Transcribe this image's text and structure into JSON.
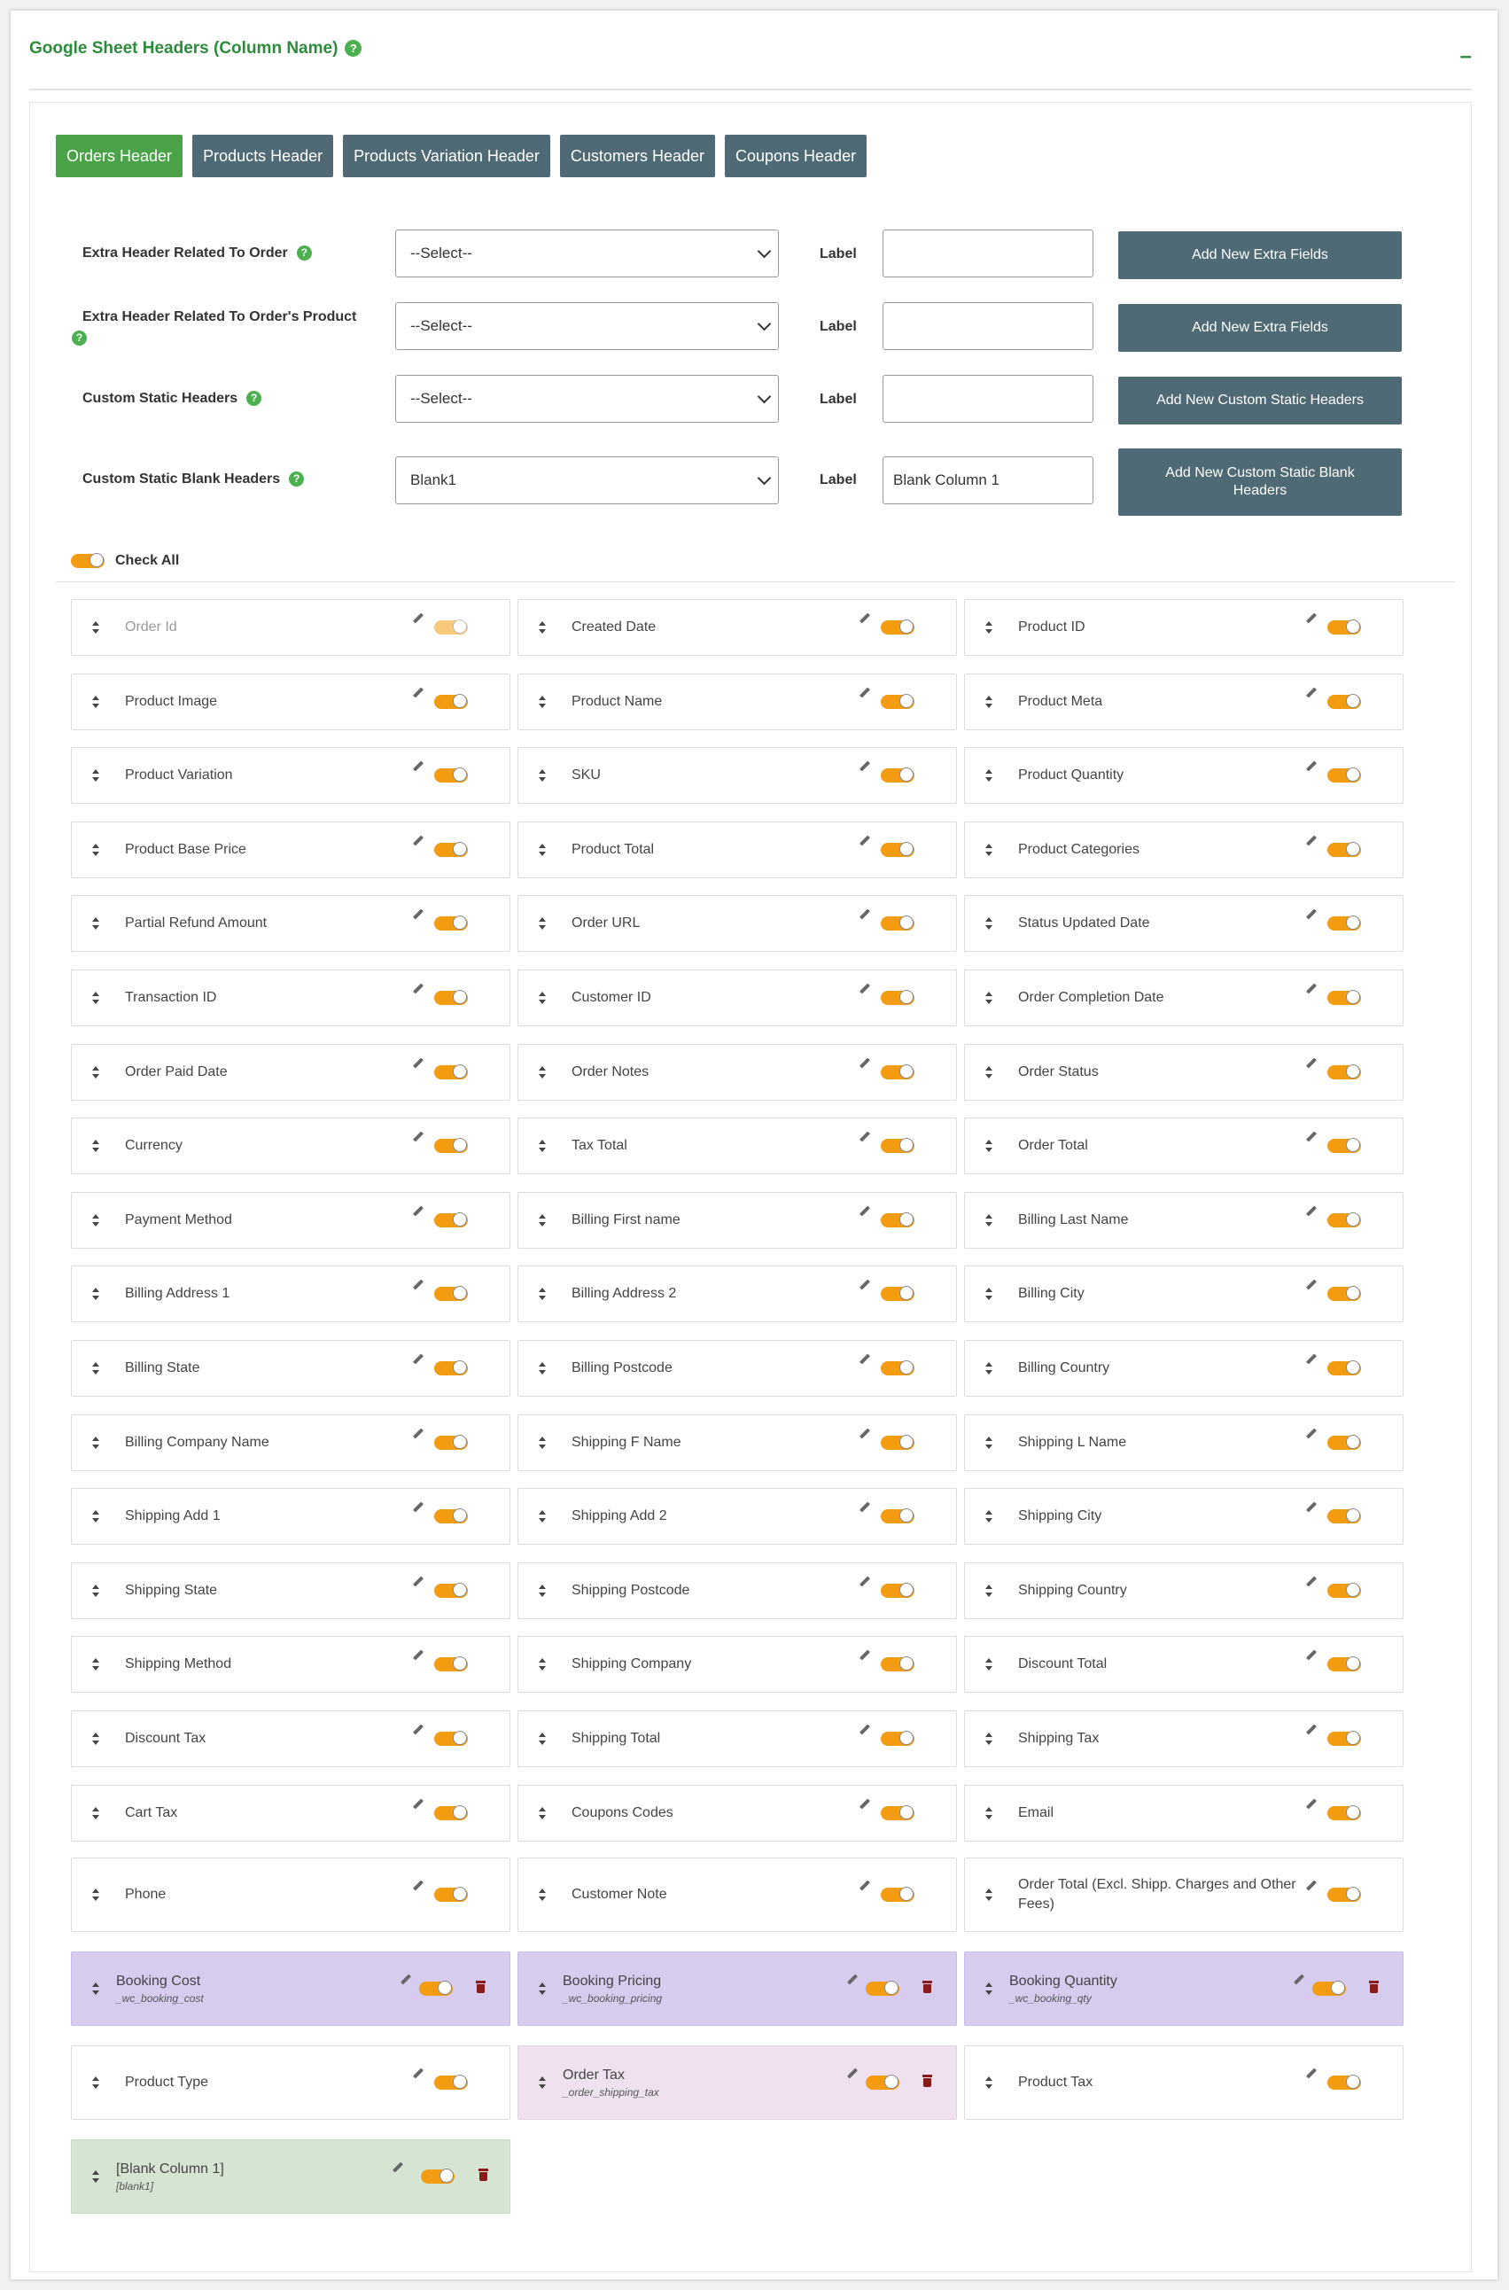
{
  "panel": {
    "title": "Google Sheet Headers (Column Name)",
    "help": "?",
    "collapse": "–"
  },
  "tabs": [
    "Orders Header",
    "Products Header",
    "Products Variation Header",
    "Customers Header",
    "Coupons Header"
  ],
  "form": {
    "label_word": "Label",
    "rows": [
      {
        "label": "Extra Header Related To Order",
        "select": "--Select--",
        "input": "",
        "button": "Add New Extra Fields"
      },
      {
        "label": "Extra Header Related To Order's Product",
        "select": "--Select--",
        "input": "",
        "button": "Add New Extra Fields"
      },
      {
        "label": "Custom Static Headers",
        "select": "--Select--",
        "input": "",
        "button": "Add New Custom Static Headers"
      },
      {
        "label": "Custom Static Blank Headers",
        "select": "Blank1",
        "input": "Blank Column 1",
        "button": "Add New Custom Static Blank Headers"
      }
    ]
  },
  "check_all": {
    "label": "Check All",
    "on": true
  },
  "columns": [
    {
      "name": "Order Id",
      "disabled": true
    },
    {
      "name": "Created Date"
    },
    {
      "name": "Product ID"
    },
    {
      "name": "Product Image"
    },
    {
      "name": "Product Name"
    },
    {
      "name": "Product Meta"
    },
    {
      "name": "Product Variation"
    },
    {
      "name": "SKU"
    },
    {
      "name": "Product Quantity"
    },
    {
      "name": "Product Base Price"
    },
    {
      "name": "Product Total"
    },
    {
      "name": "Product Categories"
    },
    {
      "name": "Partial Refund Amount"
    },
    {
      "name": "Order URL"
    },
    {
      "name": "Status Updated Date"
    },
    {
      "name": "Transaction ID"
    },
    {
      "name": "Customer ID"
    },
    {
      "name": "Order Completion Date"
    },
    {
      "name": "Order Paid Date"
    },
    {
      "name": "Order Notes"
    },
    {
      "name": "Order Status"
    },
    {
      "name": "Currency"
    },
    {
      "name": "Tax Total"
    },
    {
      "name": "Order Total"
    },
    {
      "name": "Payment Method"
    },
    {
      "name": "Billing First name"
    },
    {
      "name": "Billing Last Name"
    },
    {
      "name": "Billing Address 1"
    },
    {
      "name": "Billing Address 2"
    },
    {
      "name": "Billing City"
    },
    {
      "name": "Billing State"
    },
    {
      "name": "Billing Postcode"
    },
    {
      "name": "Billing Country"
    },
    {
      "name": "Billing Company Name"
    },
    {
      "name": "Shipping F Name"
    },
    {
      "name": "Shipping L Name"
    },
    {
      "name": "Shipping Add 1"
    },
    {
      "name": "Shipping Add 2"
    },
    {
      "name": "Shipping City"
    },
    {
      "name": "Shipping State"
    },
    {
      "name": "Shipping Postcode"
    },
    {
      "name": "Shipping Country"
    },
    {
      "name": "Shipping Method"
    },
    {
      "name": "Shipping Company"
    },
    {
      "name": "Discount Total"
    },
    {
      "name": "Discount Tax"
    },
    {
      "name": "Shipping Total"
    },
    {
      "name": "Shipping Tax"
    },
    {
      "name": "Cart Tax"
    },
    {
      "name": "Coupons Codes"
    },
    {
      "name": "Email"
    },
    {
      "name": "Phone",
      "tall": true
    },
    {
      "name": "Customer Note",
      "tall": true
    },
    {
      "name": "Order Total (Excl. Shipp. Charges and Other Fees)",
      "tall": true
    },
    {
      "name": "Booking Cost",
      "slug": "_wc_booking_cost",
      "kind": "purple",
      "tall": true
    },
    {
      "name": "Booking Pricing",
      "slug": "_wc_booking_pricing",
      "kind": "purple",
      "tall": true
    },
    {
      "name": "Booking Quantity",
      "slug": "_wc_booking_qty",
      "kind": "purple",
      "tall": true
    },
    {
      "name": "Product Type",
      "tall": true
    },
    {
      "name": "Order Tax",
      "slug": "_order_shipping_tax",
      "kind": "pink",
      "tall": true
    },
    {
      "name": "Product Tax",
      "tall": true
    },
    {
      "name": "[Blank Column 1]",
      "slug": "[blank1]",
      "kind": "green",
      "tall": true
    }
  ],
  "colors": {
    "accent_green": "#4aa348",
    "tab_slate": "#4f6a74",
    "toggle_orange": "#f39c12",
    "purple_card": "#d7cbee",
    "pink_card": "#efe1f0",
    "green_card": "#d6e4d2"
  },
  "icons": {
    "sort": "sort-arrows-icon",
    "edit": "pencil-icon",
    "delete": "trash-icon",
    "help": "question-circle-icon"
  }
}
